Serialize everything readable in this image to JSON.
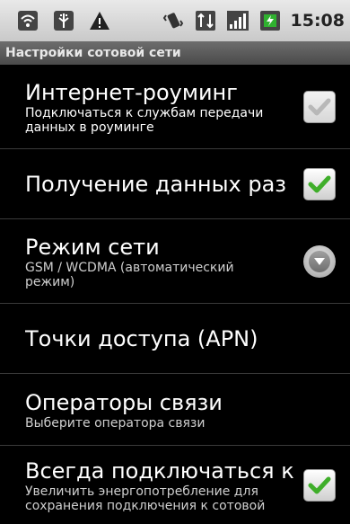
{
  "status_bar": {
    "time": "15:08",
    "icons": [
      "wifi-icon",
      "usb-debug-icon",
      "warning-icon",
      "vibrate-icon",
      "network-type-icon",
      "signal-icon",
      "battery-icon"
    ]
  },
  "screen": {
    "title": "Настройки сотовой сети"
  },
  "settings": [
    {
      "title": "Интернет-роуминг",
      "summary": "Подключаться к службам передачи данных в роуминге",
      "widget": "checkbox",
      "checked": true,
      "enabled": false
    },
    {
      "title": "Получение данных раз",
      "summary": "",
      "widget": "checkbox",
      "checked": true,
      "enabled": true
    },
    {
      "title": "Режим сети",
      "summary": "GSM / WCDMA (автоматический режим)",
      "widget": "dropdown"
    },
    {
      "title": "Точки доступа (APN)",
      "summary": ""
    },
    {
      "title": "Операторы связи",
      "summary": "Выберите оператора связи"
    },
    {
      "title": "Всегда подключаться к",
      "summary": "Увеличить энергопотребление для сохранения подключения к сотовой",
      "widget": "checkbox",
      "checked": true,
      "enabled": true
    }
  ],
  "colors": {
    "check_green": "#3fae2a",
    "check_disabled": "#b8b8b8",
    "background": "#000000"
  }
}
